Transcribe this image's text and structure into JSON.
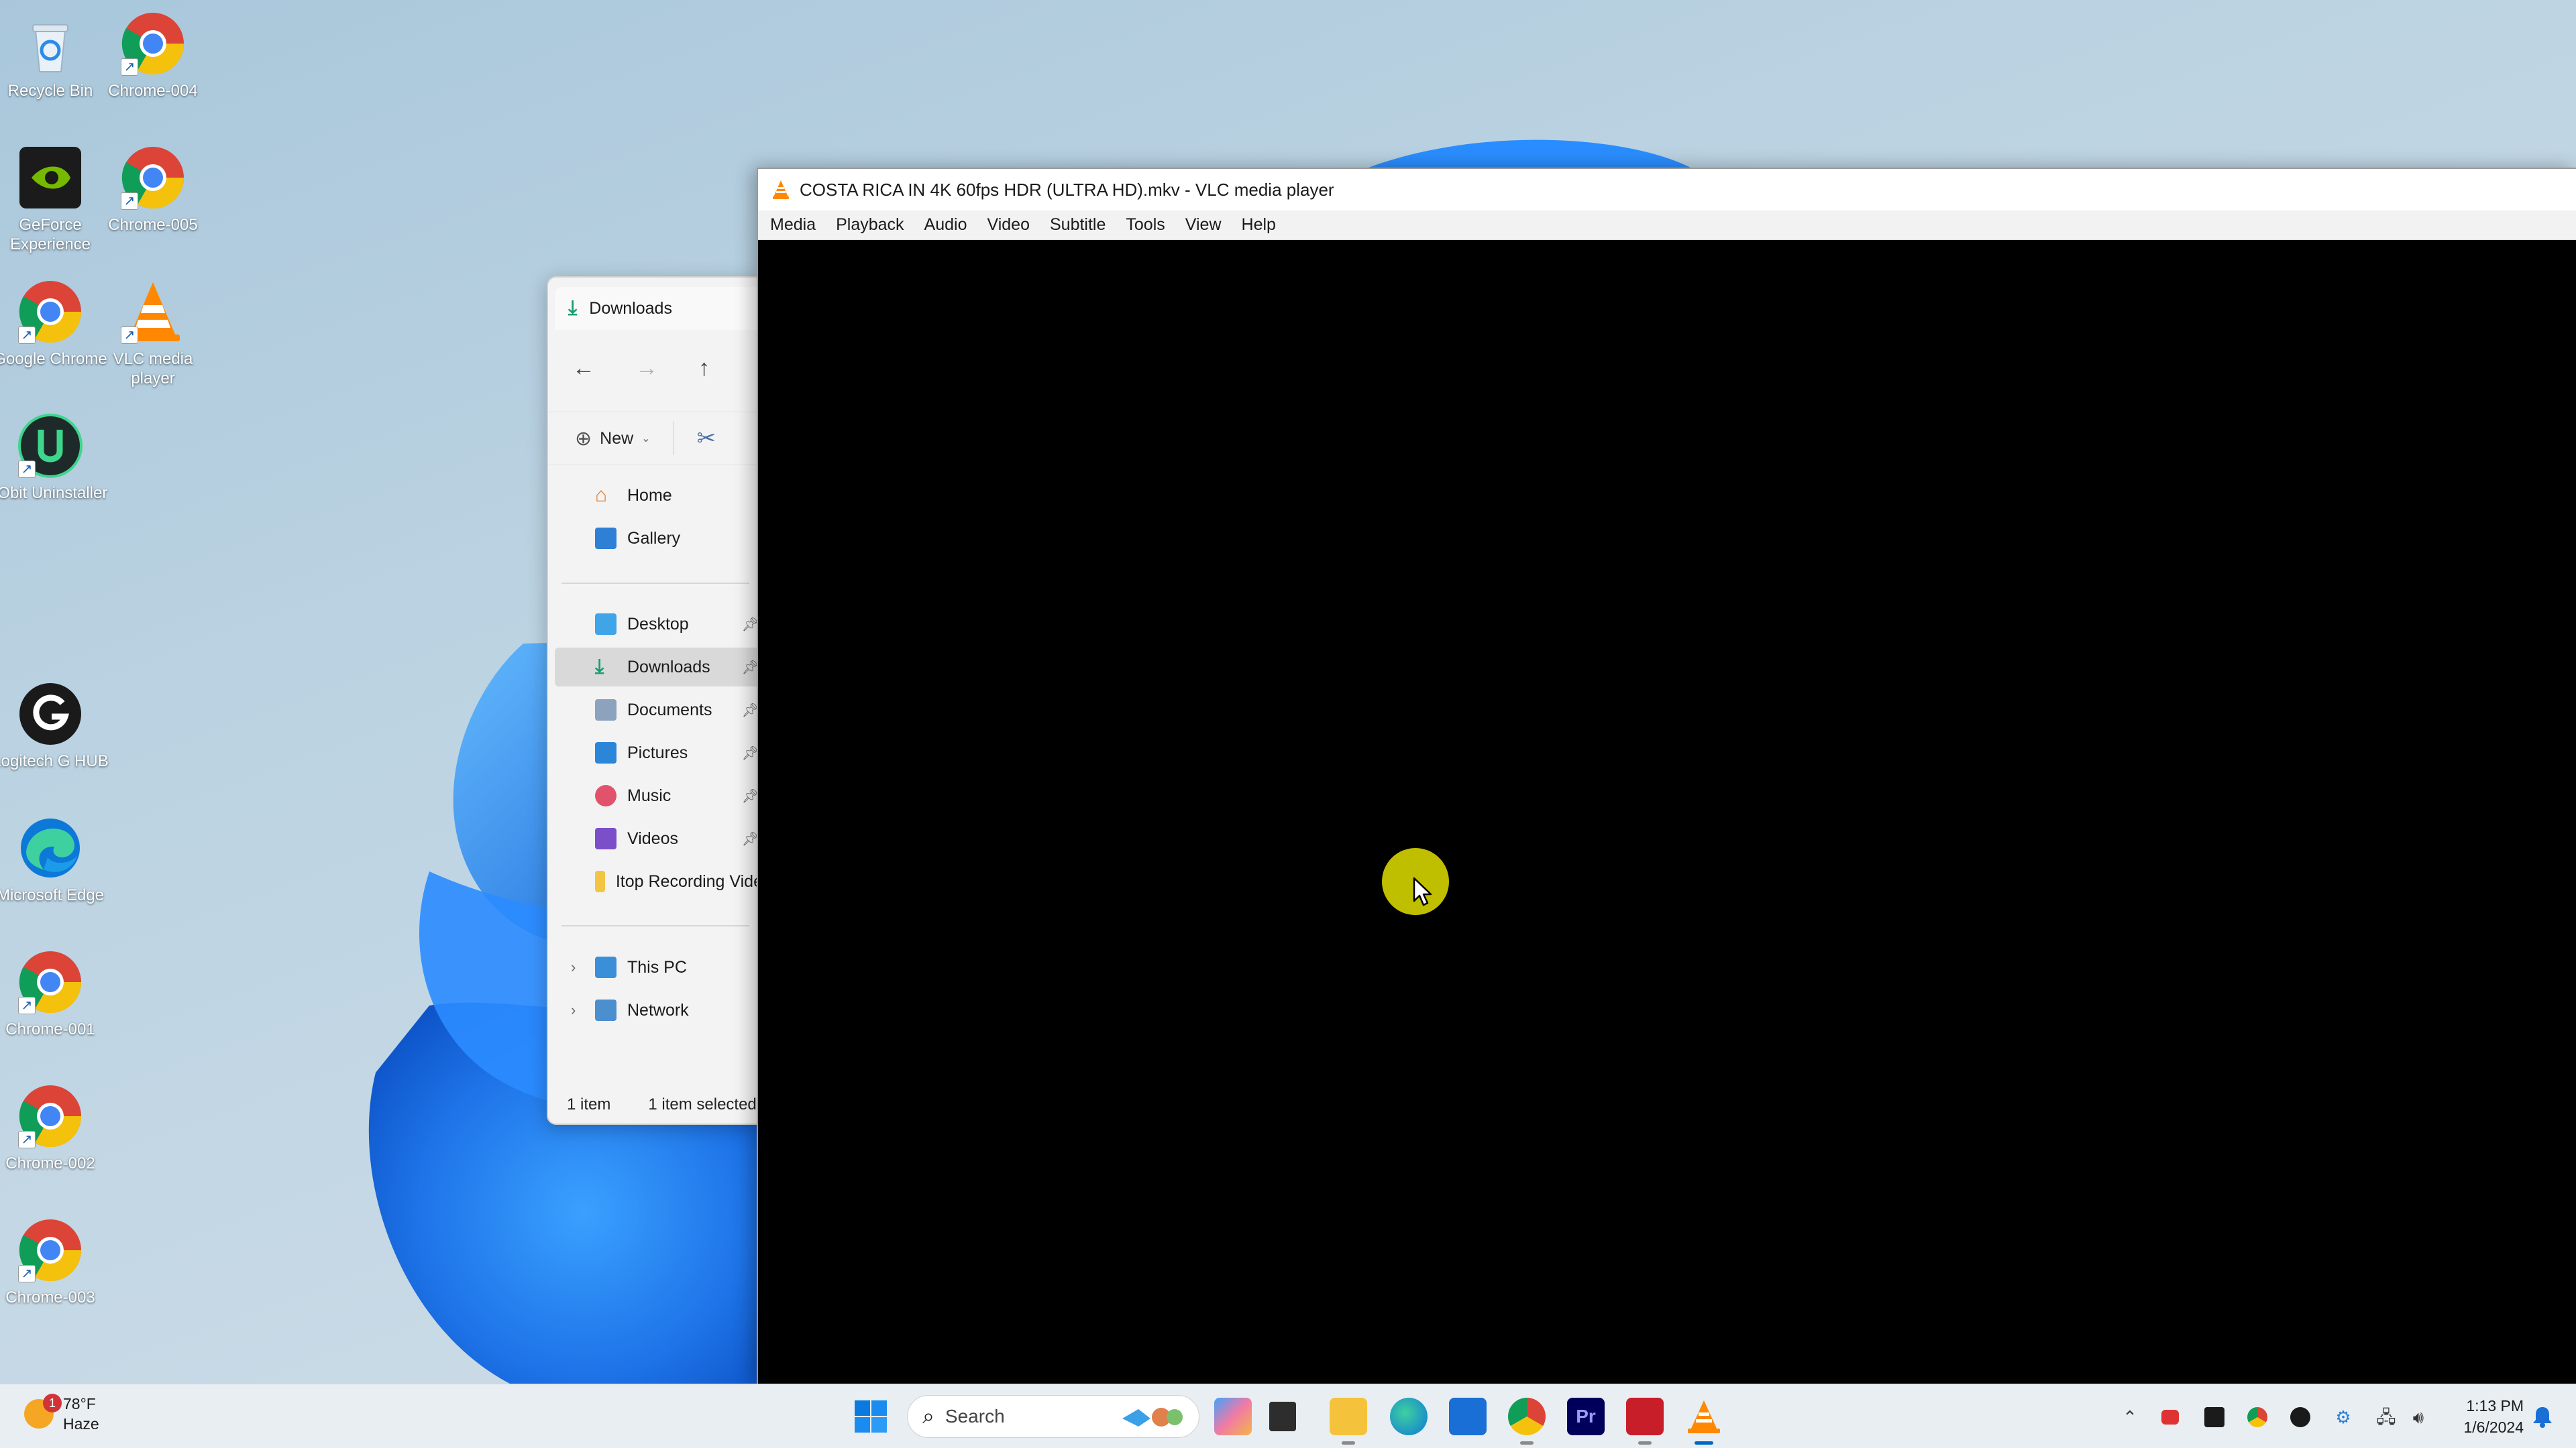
{
  "desktop": {
    "icons": [
      {
        "label": "Recycle Bin",
        "icon": "recycle-bin-icon"
      },
      {
        "label": "Chrome-004",
        "icon": "chrome-icon"
      },
      {
        "label": "GeForce Experience",
        "icon": "geforce-icon"
      },
      {
        "label": "Chrome-005",
        "icon": "chrome-icon"
      },
      {
        "label": "Google Chrome",
        "icon": "chrome-icon"
      },
      {
        "label": "VLC media player",
        "icon": "vlc-icon"
      },
      {
        "label": "IObit Uninstaller",
        "icon": "iobit-icon"
      },
      {
        "label": "Logitech G HUB",
        "icon": "logitech-icon"
      },
      {
        "label": "Microsoft Edge",
        "icon": "edge-icon"
      },
      {
        "label": "Chrome-001",
        "icon": "chrome-icon"
      },
      {
        "label": "Chrome-002",
        "icon": "chrome-icon"
      },
      {
        "label": "Chrome-003",
        "icon": "chrome-icon"
      }
    ]
  },
  "explorer": {
    "tab_title": "Downloads",
    "toolbar": {
      "new_label": "New"
    },
    "nav": {
      "home": "Home",
      "gallery": "Gallery",
      "desktop": "Desktop",
      "downloads": "Downloads",
      "documents": "Documents",
      "pictures": "Pictures",
      "music": "Music",
      "videos": "Videos",
      "itop": "Itop Recording Vide",
      "this_pc": "This PC",
      "network": "Network"
    },
    "status": {
      "count": "1 item",
      "selected": "1 item selected"
    }
  },
  "vlc": {
    "title": "COSTA RICA IN 4K 60fps HDR (ULTRA HD).mkv - VLC media player",
    "menu": [
      "Media",
      "Playback",
      "Audio",
      "Video",
      "Subtitle",
      "Tools",
      "View",
      "Help"
    ]
  },
  "taskbar": {
    "weather": {
      "temp": "78°F",
      "condition": "Haze",
      "badge": "1"
    },
    "search_placeholder": "Search",
    "clock": {
      "time": "1:13 PM",
      "date": "1/6/2024"
    }
  },
  "colors": {
    "accent": "#0067c0",
    "cursor_highlight": "#dada00",
    "vlc_orange": "#ff8800"
  }
}
